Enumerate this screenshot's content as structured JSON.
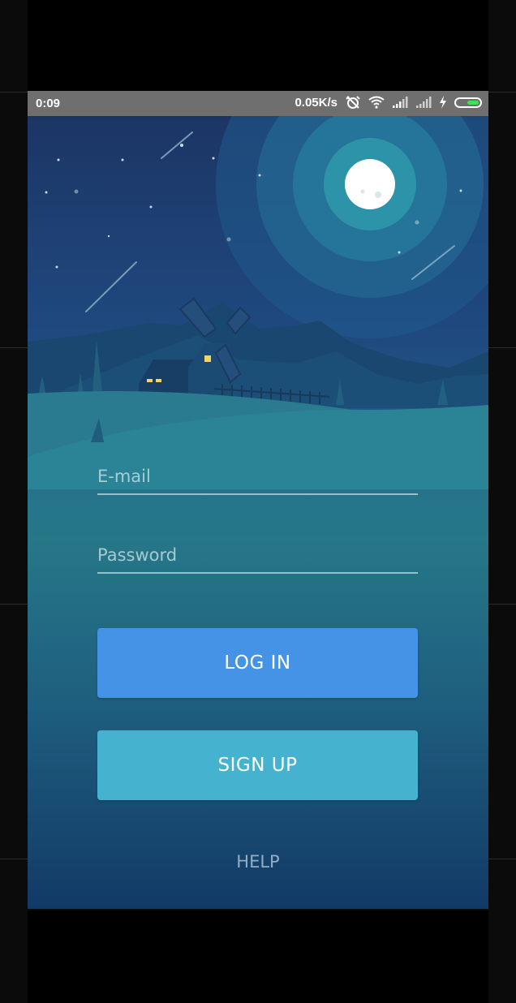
{
  "status_bar": {
    "time": "0:09",
    "speed": "0.05K/s",
    "icons": [
      "alarm-off-icon",
      "wifi-icon",
      "signal-icon",
      "signal-icon",
      "charging-icon",
      "battery-icon"
    ],
    "battery_color": "#3fe05a"
  },
  "login": {
    "email_placeholder": "E-mail",
    "password_placeholder": "Password",
    "login_label": "LOG IN",
    "signup_label": "SIGN UP",
    "help_label": "HELP"
  },
  "colors": {
    "login_button": "#4593e6",
    "signup_button": "#45b3cf",
    "moon": "#ffffff"
  }
}
